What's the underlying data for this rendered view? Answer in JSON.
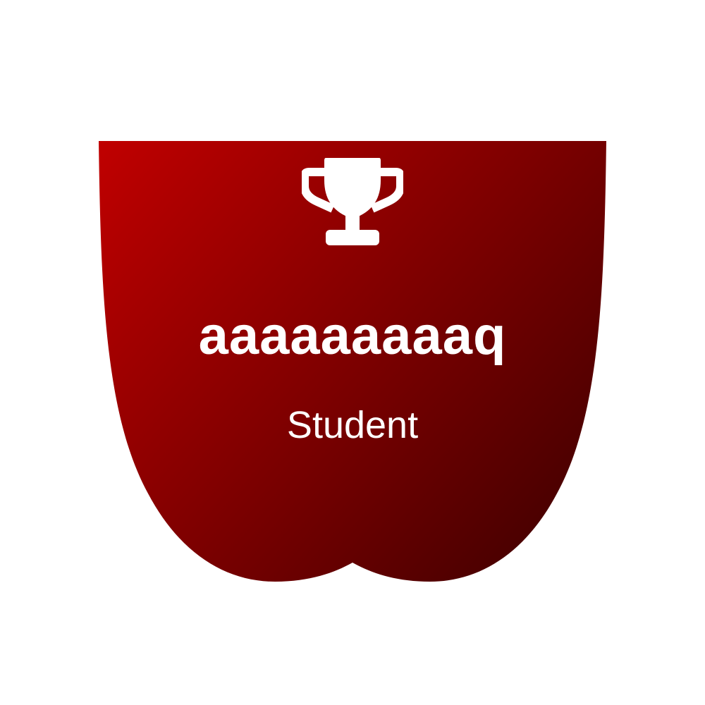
{
  "badge": {
    "name": "aaaaaaaaaq",
    "role": "Student",
    "icon": "trophy-icon",
    "colors": {
      "gradient_start": "#c00000",
      "gradient_end": "#3a0000",
      "text": "#ffffff",
      "background": "#ffffff"
    }
  }
}
